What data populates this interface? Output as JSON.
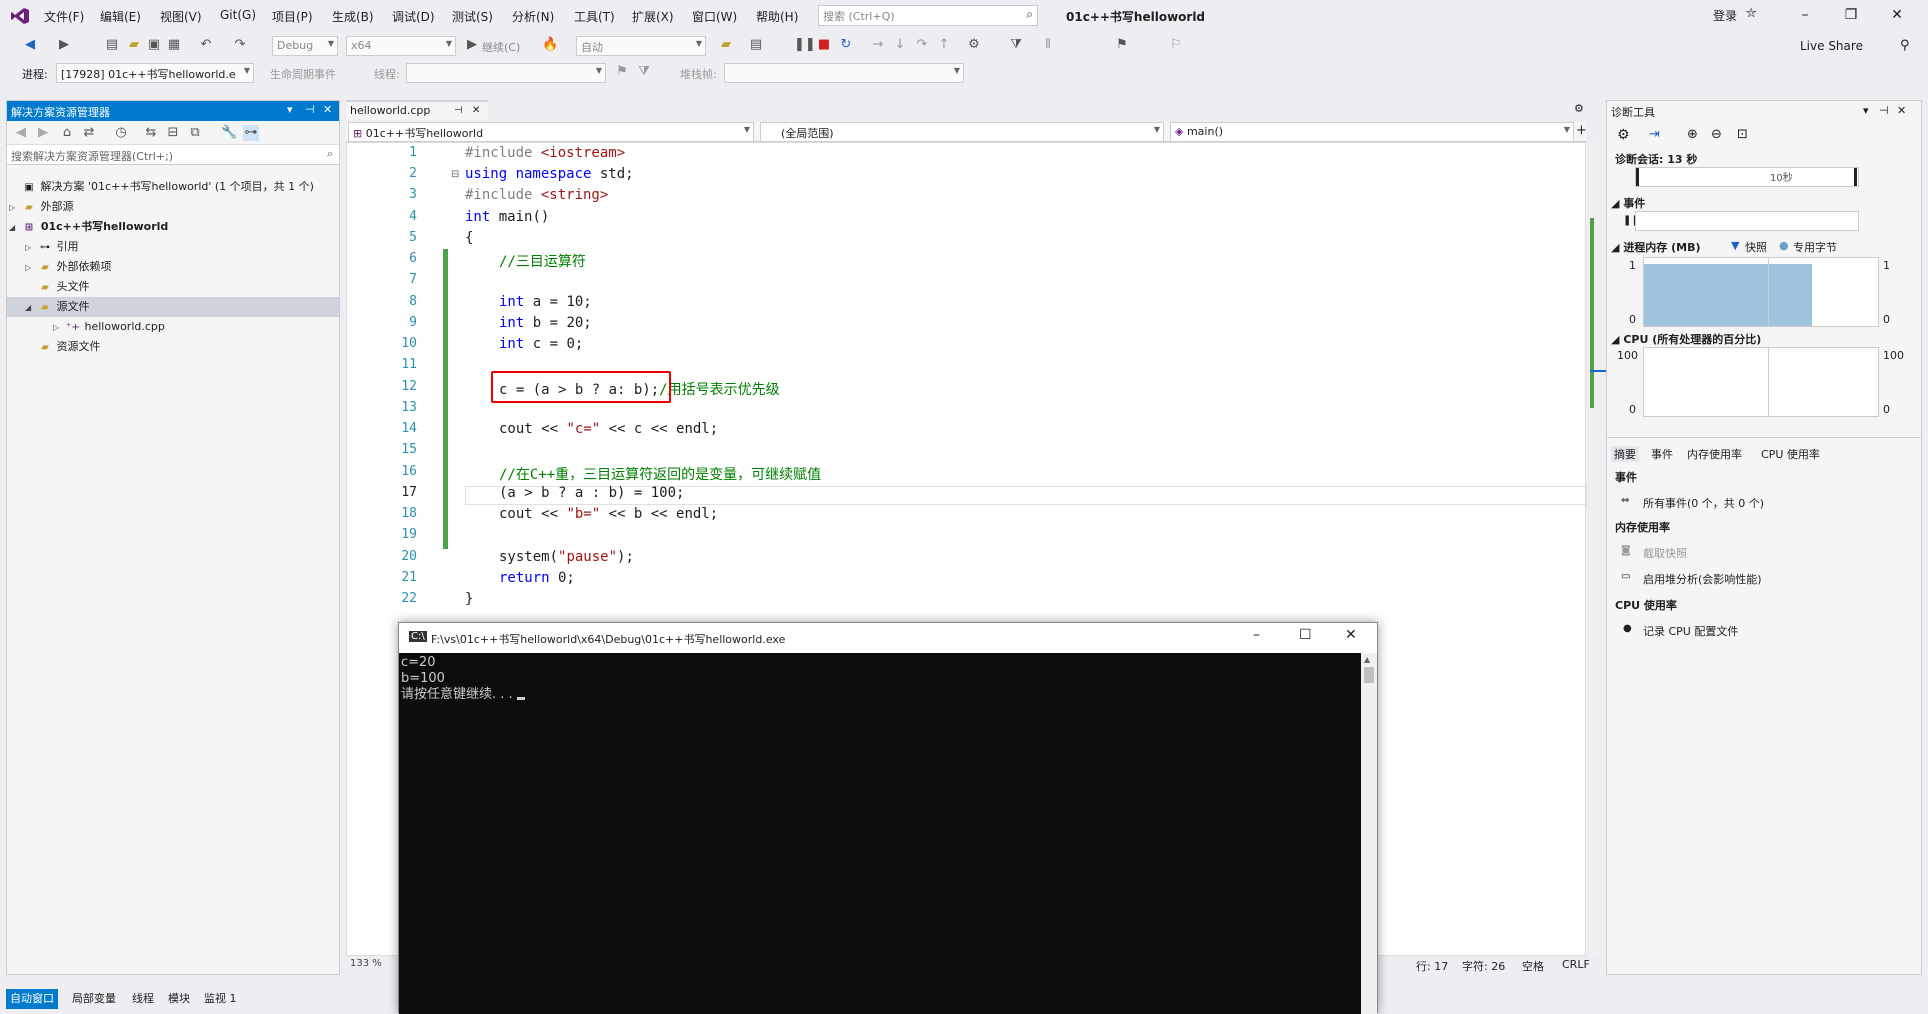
{
  "title": {
    "menus": [
      "文件(F)",
      "编辑(E)",
      "视图(V)",
      "Git(G)",
      "项目(P)",
      "生成(B)",
      "调试(D)",
      "测试(S)",
      "分析(N)",
      "工具(T)",
      "扩展(X)",
      "窗口(W)",
      "帮助(H)"
    ],
    "search_placeholder": "搜索 (Ctrl+Q)",
    "project": "01c++书写helloworld",
    "login": "登录"
  },
  "toolbar": {
    "config": "Debug",
    "platform": "x64",
    "continue": "继续(C)",
    "auto": "自动",
    "live_share": "Live Share"
  },
  "toolbar2": {
    "process_label": "进程:",
    "process_value": "[17928] 01c++书写helloworld.e",
    "lifecycle_label": "生命周期事件",
    "thread_label": "线程:",
    "stack_label": "堆栈帧:"
  },
  "solution_explorer": {
    "title": "解决方案资源管理器",
    "search": "搜索解决方案资源管理器(Ctrl+;)",
    "items": [
      {
        "label": "解决方案 '01c++书写helloworld' (1 个项目，共 1 个)",
        "icon": "solution-icon"
      },
      {
        "label": "外部源",
        "icon": "folder-icon"
      },
      {
        "label": "01c++书写helloworld",
        "icon": "project-icon"
      },
      {
        "label": "引用",
        "icon": "reference-icon"
      },
      {
        "label": "外部依赖项",
        "icon": "folder-icon"
      },
      {
        "label": "头文件",
        "icon": "folder-icon"
      },
      {
        "label": "源文件",
        "icon": "folder-icon"
      },
      {
        "label": "helloworld.cpp",
        "icon": "cpp-file-icon"
      },
      {
        "label": "资源文件",
        "icon": "folder-icon"
      }
    ]
  },
  "editor": {
    "tab": "helloworld.cpp",
    "nav_project": "01c++书写helloworld",
    "nav_scope": "(全局范围)",
    "nav_member": "main()",
    "zoom": "133 %",
    "line_numbers": [
      "1",
      "2",
      "3",
      "4",
      "5",
      "6",
      "7",
      "8",
      "9",
      "10",
      "11",
      "12",
      "13",
      "14",
      "15",
      "16",
      "17",
      "18",
      "19",
      "20",
      "21",
      "22"
    ],
    "status_line": "行: 17",
    "status_col": "字符: 26",
    "status_space": "空格",
    "status_crlf": "CRLF",
    "lines": {
      "l1a": "#include ",
      "l1b": "<iostream>",
      "l2a": "using namespace",
      "l2b": " std;",
      "l3a": "#include ",
      "l3b": "<string>",
      "l4a": "int",
      "l4b": " main()",
      "l5": "{",
      "l6": "//三目运算符",
      "l8a": "int",
      "l8b": " a = 10;",
      "l9a": "int",
      "l9b": " b = 20;",
      "l10a": "int",
      "l10b": " c = 0;",
      "l12a": "c = (a > b ? a: b);",
      "l12b": "/用括号表示优先级",
      "l14a": "cout << ",
      "l14b": "\"c=\"",
      "l14c": " << c << endl;",
      "l16": "//在C++重，三目运算符返回的是变量，可继续赋值",
      "l17": "(a > b ? a : b) = 100;",
      "l18a": "cout << ",
      "l18b": "\"b=\"",
      "l18c": " << b << endl;",
      "l20a": "system(",
      "l20b": "\"pause\"",
      "l20c": ");",
      "l21a": "return",
      "l21b": " 0;",
      "l22": "}"
    }
  },
  "diagnostics": {
    "title": "诊断工具",
    "session": "诊断会话: 13 秒",
    "tick": "10秒",
    "events": "事件",
    "memory": "进程内存 (MB)",
    "snapshot_legend": "快照",
    "private_legend": "专用字节",
    "mem_max": "1",
    "mem_min": "0",
    "cpu": "CPU (所有处理器的百分比)",
    "cpu_max": "100",
    "cpu_min": "0",
    "tabs": [
      "摘要",
      "事件",
      "内存使用率",
      "CPU 使用率"
    ],
    "sec_events": "事件",
    "all_events": "所有事件(0 个，共 0 个)",
    "sec_memory": "内存使用率",
    "take_snapshot": "截取快照",
    "heap_profile": "启用堆分析(会影响性能)",
    "sec_cpu": "CPU 使用率",
    "record_cpu": "记录 CPU 配置文件"
  },
  "console": {
    "title": "F:\\vs\\01c++书写helloworld\\x64\\Debug\\01c++书写helloworld.exe",
    "output": "c=20\nb=100\n请按任意键继续. . . "
  },
  "bottom_tabs": [
    "自动窗口",
    "局部变量",
    "线程",
    "模块",
    "监视 1"
  ]
}
